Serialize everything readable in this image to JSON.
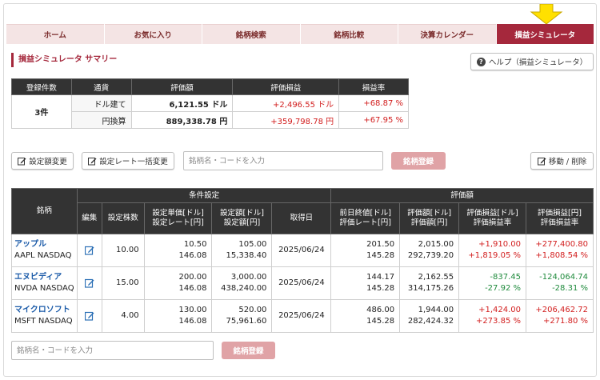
{
  "tabs": [
    {
      "label": "ホーム",
      "active": false
    },
    {
      "label": "お気に入り",
      "active": false
    },
    {
      "label": "銘柄検索",
      "active": false
    },
    {
      "label": "銘柄比較",
      "active": false
    },
    {
      "label": "決算カレンダー",
      "active": false
    },
    {
      "label": "損益シミュレータ",
      "active": true
    }
  ],
  "summary_title": "損益シミュレータ サマリー",
  "help_label": "ヘルプ（損益シミュレータ）",
  "summary_table": {
    "headers": [
      "登録件数",
      "通貨",
      "評価額",
      "評価損益",
      "損益率"
    ],
    "count": "3件",
    "rows": [
      {
        "currency": "ドル建て",
        "value": "6,121.55 ドル",
        "pl": "+2,496.55 ドル",
        "rate": "+68.87 %"
      },
      {
        "currency": "円換算",
        "value": "889,338.78 円",
        "pl": "+359,798.78 円",
        "rate": "+67.95 %"
      }
    ]
  },
  "toolbar": {
    "change_amount": "設定額変更",
    "change_rate": "設定レート一括変更",
    "search_placeholder": "銘柄名・コードを入力",
    "register": "銘柄登録",
    "move_delete": "移動 / 削除"
  },
  "detail_table": {
    "group_conditions": "条件設定",
    "group_valuation": "評価額",
    "col_stock": "銘柄",
    "col_edit": "編集",
    "col_shares": "設定株数",
    "col_unit_price": [
      "設定単価[ドル]",
      "設定レート[円]"
    ],
    "col_amount": [
      "設定額[ドル]",
      "設定額[円]"
    ],
    "col_date": "取得日",
    "col_prev_close": [
      "前日終値[ドル]",
      "評価レート[円]"
    ],
    "col_val_usd": [
      "評価額[ドル]",
      "評価額[円]"
    ],
    "col_pl_usd": [
      "評価損益[ドル]",
      "評価損益率"
    ],
    "col_pl_jpy": [
      "評価損益[円]",
      "評価損益率"
    ],
    "rows": [
      {
        "name": "アップル",
        "code": "AAPL NASDAQ",
        "shares": "10.00",
        "unit": [
          "10.50",
          "146.08"
        ],
        "amount": [
          "105.00",
          "15,338.40"
        ],
        "date": "2025/06/24",
        "prev": [
          "201.50",
          "145.28"
        ],
        "val": [
          "2,015.00",
          "292,739.20"
        ],
        "pl_usd": [
          "+1,910.00",
          "+1,819.05 %"
        ],
        "pl_jpy": [
          "+277,400.80",
          "+1,808.54 %"
        ],
        "sign": "pos"
      },
      {
        "name": "エヌビディア",
        "code": "NVDA NASDAQ",
        "shares": "15.00",
        "unit": [
          "200.00",
          "146.08"
        ],
        "amount": [
          "3,000.00",
          "438,240.00"
        ],
        "date": "2025/06/24",
        "prev": [
          "144.17",
          "145.28"
        ],
        "val": [
          "2,162.55",
          "314,175.26"
        ],
        "pl_usd": [
          "-837.45",
          "-27.92 %"
        ],
        "pl_jpy": [
          "-124,064.74",
          "-28.31 %"
        ],
        "sign": "neg"
      },
      {
        "name": "マイクロソフト",
        "code": "MSFT NASDAQ",
        "shares": "4.00",
        "unit": [
          "130.00",
          "146.08"
        ],
        "amount": [
          "520.00",
          "75,961.60"
        ],
        "date": "2025/06/24",
        "prev": [
          "486.00",
          "145.28"
        ],
        "val": [
          "1,944.00",
          "282,424.32"
        ],
        "pl_usd": [
          "+1,424.00",
          "+273.85 %"
        ],
        "pl_jpy": [
          "+206,462.72",
          "+271.80 %"
        ],
        "sign": "pos"
      }
    ]
  },
  "bottom": {
    "search_placeholder": "銘柄名・コードを入力",
    "register": "銘柄登録"
  },
  "colors": {
    "accent": "#a5283c",
    "tab_bg": "#f4e4e4",
    "positive": "#d21e1e",
    "negative": "#1f8a3c",
    "arrow": "#ffe000"
  }
}
